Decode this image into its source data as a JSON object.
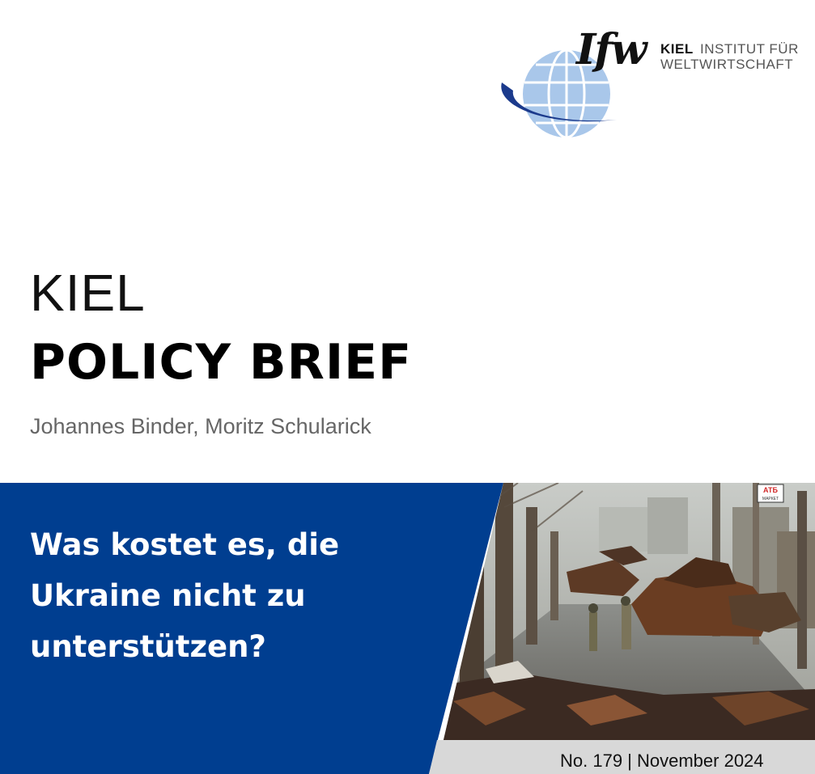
{
  "logo": {
    "wordmark": "Ifw",
    "name_bold": "KIEL",
    "name_rest": "INSTITUT FÜR",
    "name_line2": "WELTWIRTSCHAFT",
    "colors": {
      "globe": "#a9c7ea",
      "swoosh": "#1b3a8c"
    }
  },
  "series": {
    "line1": "KIEL",
    "line2": "POLICY BRIEF"
  },
  "authors": "Johannes Binder, Moritz Schularick",
  "title": "Was kostet es, die Ukraine nicht zu unterstützen?",
  "issue": "No. 179 | November 2024",
  "photo": {
    "description_icon": "war-photo-destroyed-tanks",
    "sign_text": "АТБ",
    "sign_subtext": "МАРКЕТ"
  },
  "colors": {
    "band_blue": "#003e90",
    "footer_gray": "#d8d8d8"
  }
}
